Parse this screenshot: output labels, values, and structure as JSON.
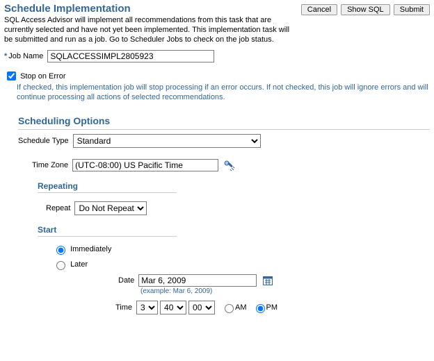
{
  "page": {
    "title": "Schedule Implementation",
    "intro": "SQL Access Advisor will implement all recommendations from this task that are currently selected and have not yet been implemented. This implementation task will be submitted and run as a job. Go to Scheduler Jobs to check on the job status."
  },
  "actions": {
    "cancel": "Cancel",
    "show_sql": "Show SQL",
    "submit": "Submit"
  },
  "job": {
    "name_label": "Job Name",
    "name_value": "SQLACCESSIMPL2805923"
  },
  "stop_on_error": {
    "label": "Stop on Error",
    "checked": true,
    "help": "If checked, this implementation job will stop processing if an error occurs. If not checked, this job will ignore errors and will continue processing all actions of selected recommendations."
  },
  "scheduling": {
    "section_title": "Scheduling Options",
    "schedule_type_label": "Schedule Type",
    "schedule_type_value": "Standard",
    "time_zone_label": "Time Zone",
    "time_zone_value": "(UTC-08:00) US Pacific Time",
    "repeating": {
      "title": "Repeating",
      "label": "Repeat",
      "value": "Do Not Repeat"
    },
    "start": {
      "title": "Start",
      "immediately_label": "Immediately",
      "later_label": "Later",
      "selected": "immediately",
      "date_label": "Date",
      "date_value": "Mar 6, 2009",
      "date_example": "(example: Mar 6, 2009)",
      "time_label": "Time",
      "hour": "3",
      "minute": "40",
      "second": "00",
      "am_label": "AM",
      "pm_label": "PM",
      "ampm": "PM"
    }
  }
}
